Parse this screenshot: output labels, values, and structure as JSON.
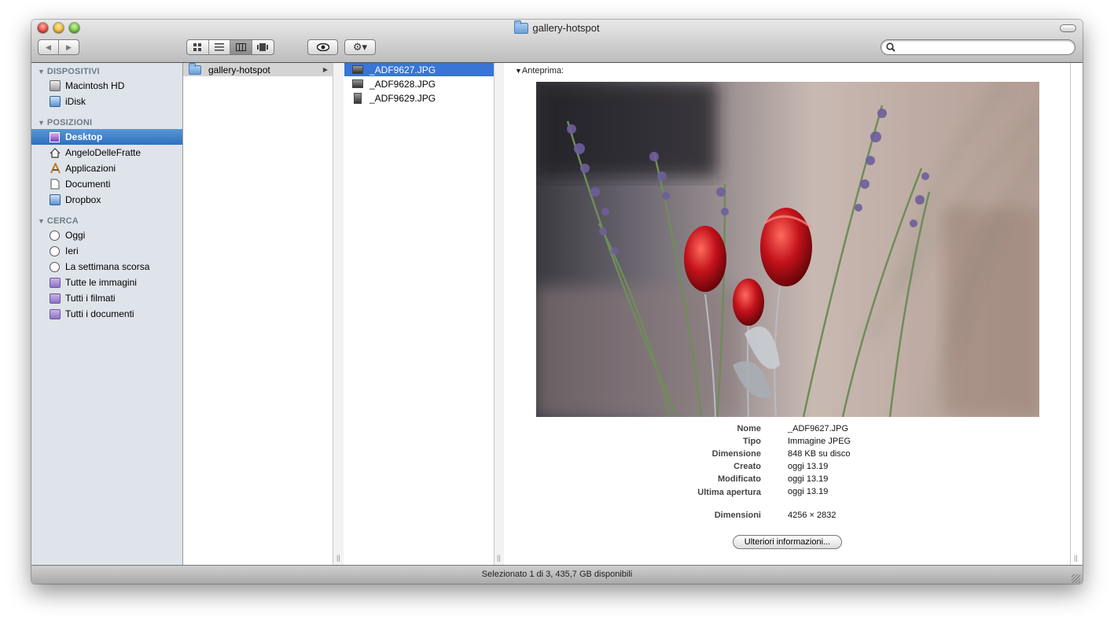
{
  "window": {
    "title": "gallery-hotspot"
  },
  "toolbar": {
    "back": "◀",
    "forward": "▶",
    "quicklook": "👁",
    "action": "⚙▾",
    "search_placeholder": ""
  },
  "sidebar": {
    "sections": [
      {
        "label": "DISPOSITIVI",
        "items": [
          "Macintosh HD",
          "iDisk"
        ]
      },
      {
        "label": "POSIZIONI",
        "items": [
          "Desktop",
          "AngeloDelleFratte",
          "Applicazioni",
          "Documenti",
          "Dropbox"
        ]
      },
      {
        "label": "CERCA",
        "items": [
          "Oggi",
          "Ieri",
          "La settimana scorsa",
          "Tutte le immagini",
          "Tutti i filmati",
          "Tutti i documenti"
        ]
      }
    ],
    "selected": "Desktop"
  },
  "column1": {
    "items": [
      "gallery-hotspot"
    ]
  },
  "column2": {
    "items": [
      "_ADF9627.JPG",
      "_ADF9628.JPG",
      "_ADF9629.JPG"
    ]
  },
  "preview": {
    "header": "Anteprima:",
    "info": [
      {
        "key": "Nome",
        "value": "_ADF9627.JPG"
      },
      {
        "key": "Tipo",
        "value": "Immagine JPEG"
      },
      {
        "key": "Dimensione",
        "value": "848 KB su disco"
      },
      {
        "key": "Creato",
        "value": "oggi 13.19"
      },
      {
        "key": "Modificato",
        "value": "oggi 13.19"
      },
      {
        "key": "Ultima apertura",
        "value": "oggi 13.19"
      },
      {
        "key": "Dimensioni",
        "value": "4256 × 2832"
      }
    ],
    "more_button": "Ulteriori informazioni..."
  },
  "status": "Selezionato 1 di 3, 435,7 GB disponibili"
}
